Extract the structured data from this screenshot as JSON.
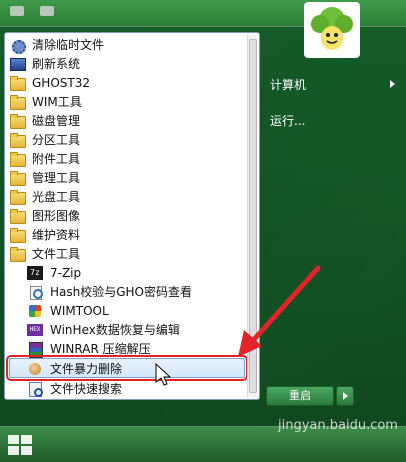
{
  "menu": {
    "items": [
      {
        "label": "清除临时文件",
        "icon": "gear-icon"
      },
      {
        "label": "刷新系统",
        "icon": "system-icon"
      },
      {
        "label": "GHOST32",
        "icon": "folder-icon"
      },
      {
        "label": "WIM工具",
        "icon": "folder-icon"
      },
      {
        "label": "磁盘管理",
        "icon": "folder-icon"
      },
      {
        "label": "分区工具",
        "icon": "folder-icon"
      },
      {
        "label": "附件工具",
        "icon": "folder-icon"
      },
      {
        "label": "管理工具",
        "icon": "folder-icon"
      },
      {
        "label": "光盘工具",
        "icon": "folder-icon"
      },
      {
        "label": "图形图像",
        "icon": "folder-icon"
      },
      {
        "label": "维护资料",
        "icon": "folder-icon"
      },
      {
        "label": "文件工具",
        "icon": "folder-icon"
      }
    ],
    "subitems": [
      {
        "label": "7-Zip",
        "icon": "zip-icon"
      },
      {
        "label": "Hash校验与GHO密码查看",
        "icon": "hash-icon"
      },
      {
        "label": "WIMTOOL",
        "icon": "wim-icon"
      },
      {
        "label": "WinHex数据恢复与编辑",
        "icon": "hex-icon"
      },
      {
        "label": "WINRAR 压缩解压",
        "icon": "rar-icon"
      },
      {
        "label": "文件暴力删除",
        "icon": "shred-icon"
      },
      {
        "label": "文件快速搜索",
        "icon": "search-icon"
      }
    ]
  },
  "right": {
    "computer": "计算机",
    "run": "运行..."
  },
  "shutdown": {
    "label": "重启"
  },
  "watermark": "jingyan.baidu.com",
  "colors": {
    "highlight_outline": "#e3232a",
    "arrow": "#e3232a"
  }
}
